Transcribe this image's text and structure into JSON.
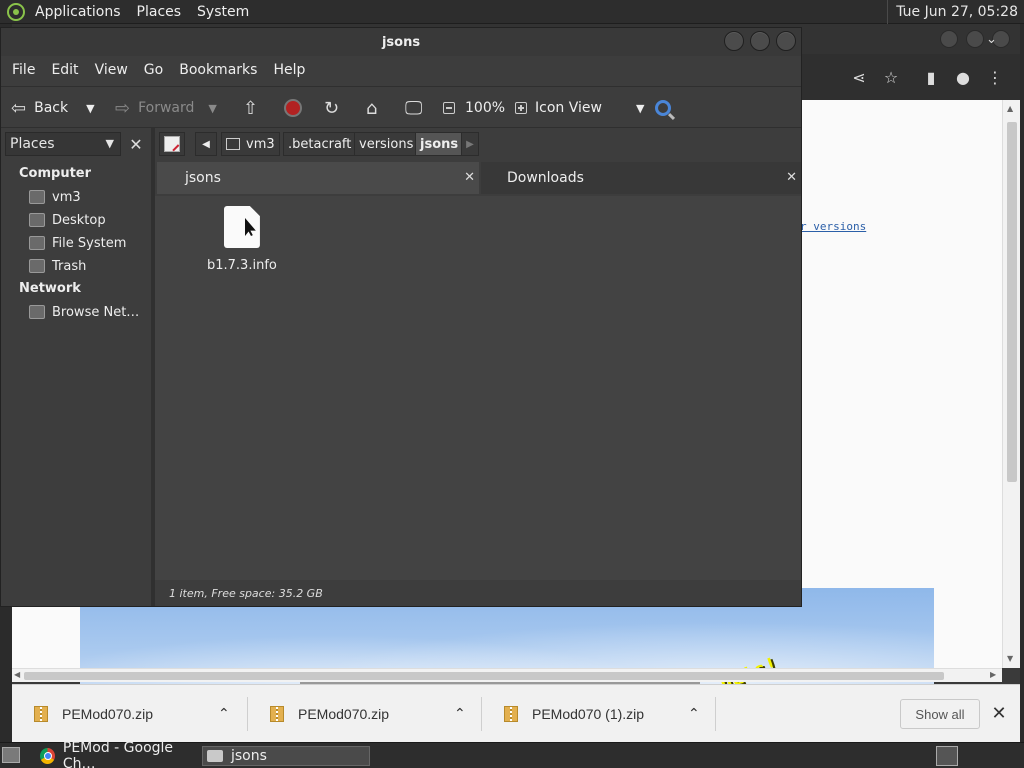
{
  "top_panel": {
    "menus": [
      "Applications",
      "Places",
      "System"
    ],
    "clock": "Tue Jun 27, 05:28"
  },
  "browser": {
    "link_text": "r versions",
    "splash_text": "contain nuts!"
  },
  "nautilus": {
    "title": "jsons",
    "menubar": [
      "File",
      "Edit",
      "View",
      "Go",
      "Bookmarks",
      "Help"
    ],
    "toolbar": {
      "back": "Back",
      "forward": "Forward",
      "zoom": "100%",
      "view_mode": "Icon View"
    },
    "sidebar": {
      "combo": "Places",
      "computer_heading": "Computer",
      "computer_items": [
        "vm3",
        "Desktop",
        "File System",
        "Trash"
      ],
      "network_heading": "Network",
      "network_items": [
        "Browse Net…"
      ]
    },
    "path": [
      "vm3",
      ".betacraft",
      "versions",
      "jsons"
    ],
    "tabs": [
      "jsons",
      "Downloads"
    ],
    "files": [
      {
        "name": "b1.7.3.info"
      }
    ],
    "status": "1 item, Free space: 35.2 GB"
  },
  "downloads": {
    "items": [
      "PEMod070.zip",
      "PEMod070.zip",
      "PEMod070 (1).zip"
    ],
    "show_all": "Show all"
  },
  "taskbar": {
    "tasks": [
      "PEMod - Google Ch…",
      "jsons"
    ]
  }
}
